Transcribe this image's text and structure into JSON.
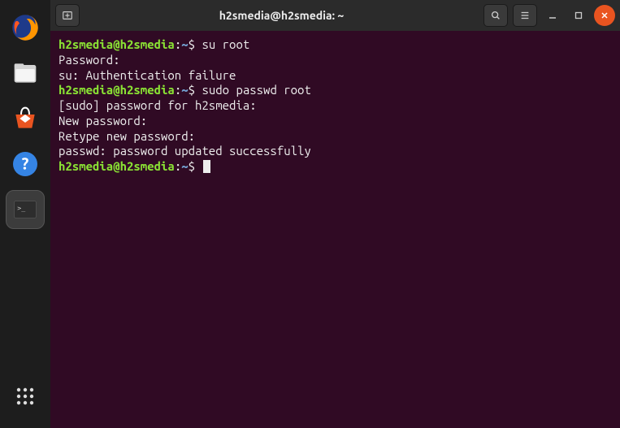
{
  "dock": {
    "items": [
      {
        "name": "firefox"
      },
      {
        "name": "files"
      },
      {
        "name": "software"
      },
      {
        "name": "help"
      },
      {
        "name": "terminal",
        "active": true
      }
    ]
  },
  "titlebar": {
    "title": "h2smedia@h2smedia: ~"
  },
  "terminal": {
    "prompt_user": "h2smedia@h2smedia",
    "prompt_path": "~",
    "prompt_symbol": "$",
    "lines": [
      {
        "type": "cmd",
        "text": "su root"
      },
      {
        "type": "out",
        "text": "Password:"
      },
      {
        "type": "out",
        "text": "su: Authentication failure"
      },
      {
        "type": "cmd",
        "text": "sudo passwd root"
      },
      {
        "type": "out",
        "text": "[sudo] password for h2smedia:"
      },
      {
        "type": "out",
        "text": "New password:"
      },
      {
        "type": "out",
        "text": "Retype new password:"
      },
      {
        "type": "out",
        "text": "passwd: password updated successfully"
      },
      {
        "type": "cmd",
        "text": "",
        "cursor": true
      }
    ]
  }
}
